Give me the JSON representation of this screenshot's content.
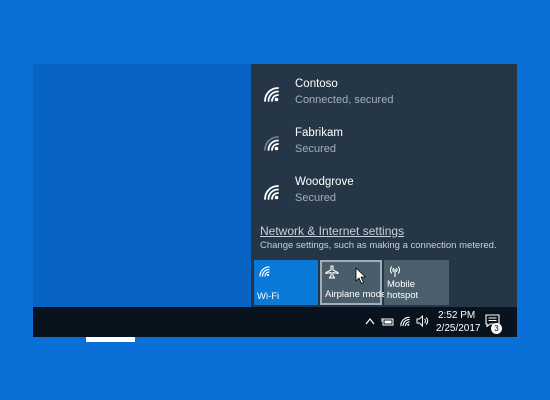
{
  "networks": [
    {
      "name": "Contoso",
      "status": "Connected, secured",
      "icon": "wifi-icon"
    },
    {
      "name": "Fabrikam",
      "status": "Secured",
      "icon": "wifi-icon"
    },
    {
      "name": "Woodgrove",
      "status": "Secured",
      "icon": "wifi-icon"
    }
  ],
  "settings": {
    "link": "Network & Internet settings",
    "description": "Change settings, such as making a connection metered."
  },
  "quick_actions": [
    {
      "label": "Wi-Fi",
      "icon": "wifi-icon",
      "state": "on"
    },
    {
      "label": "Airplane mode",
      "icon": "airplane-icon",
      "state": "off"
    },
    {
      "label_line1": "Mobile",
      "label_line2": "hotspot",
      "icon": "hotspot-icon",
      "state": "off"
    }
  ],
  "taskbar": {
    "time": "2:52 PM",
    "date": "2/25/2017",
    "notification_count": "3"
  },
  "colors": {
    "desktop": "#0a6fd6",
    "flyout": "#253746",
    "accent": "#0a79d8",
    "taskbar": "#08131e"
  }
}
